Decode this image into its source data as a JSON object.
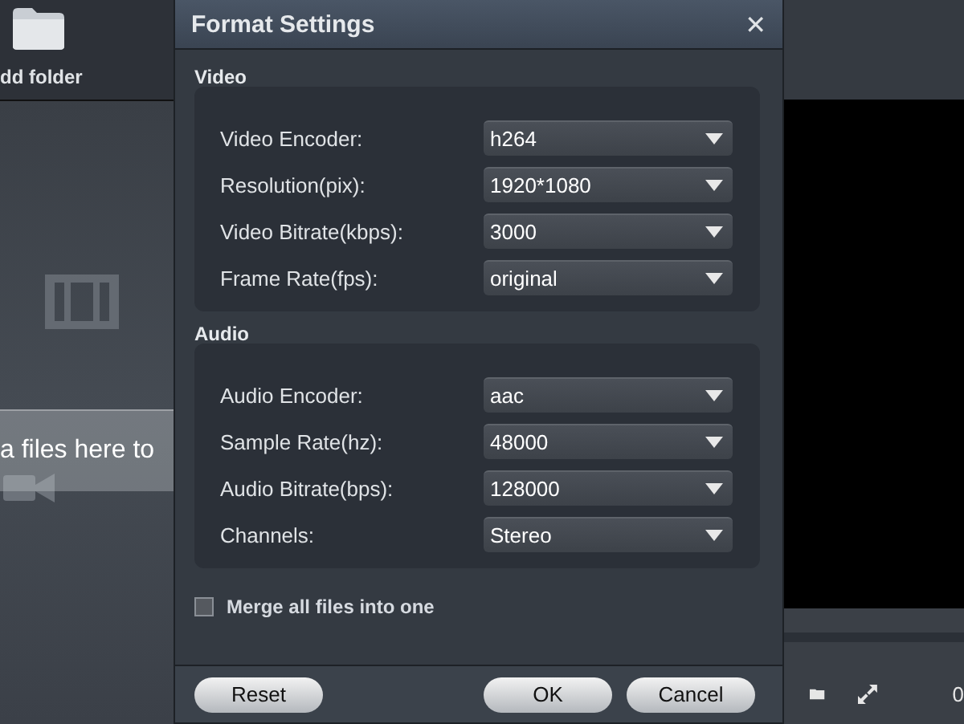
{
  "app": {
    "toolbar_label": "dd folder",
    "drop_hint": "a files here to",
    "time": "0"
  },
  "dialog": {
    "title": "Format Settings",
    "close": "✕",
    "sections": [
      {
        "title": "Video",
        "fields": [
          {
            "label": "Video Encoder:",
            "value": "h264"
          },
          {
            "label": "Resolution(pix):",
            "value": "1920*1080"
          },
          {
            "label": "Video Bitrate(kbps):",
            "value": "3000"
          },
          {
            "label": "Frame Rate(fps):",
            "value": "original"
          }
        ]
      },
      {
        "title": "Audio",
        "fields": [
          {
            "label": "Audio Encoder:",
            "value": "aac"
          },
          {
            "label": "Sample Rate(hz):",
            "value": "48000"
          },
          {
            "label": "Audio Bitrate(bps):",
            "value": "128000"
          },
          {
            "label": "Channels:",
            "value": "Stereo"
          }
        ]
      }
    ],
    "merge": {
      "label": "Merge all files into one",
      "checked": false
    },
    "buttons": [
      {
        "label": "Reset",
        "kind": "left"
      },
      {
        "label": "OK",
        "kind": "right"
      },
      {
        "label": "Cancel",
        "kind": "right"
      }
    ]
  }
}
